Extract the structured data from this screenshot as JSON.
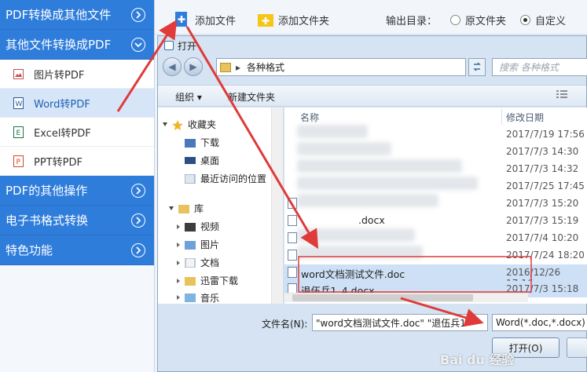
{
  "sidebar": {
    "sections": [
      {
        "label": "PDF转换成其他文件",
        "state": "collapsed"
      },
      {
        "label": "其他文件转换成PDF",
        "state": "expanded"
      }
    ],
    "items": [
      {
        "label": "图片转PDF",
        "icon": "image-icon"
      },
      {
        "label": "Word转PDF",
        "icon": "word-icon",
        "selected": true
      },
      {
        "label": "Excel转PDF",
        "icon": "excel-icon"
      },
      {
        "label": "PPT转PDF",
        "icon": "ppt-icon"
      }
    ],
    "lower_sections": [
      {
        "label": "PDF的其他操作"
      },
      {
        "label": "电子书格式转换"
      },
      {
        "label": "特色功能"
      }
    ]
  },
  "toolbar": {
    "add_file": "添加文件",
    "add_folder": "添加文件夹",
    "output_label": "输出目录：",
    "radio_source": "原文件夹",
    "radio_custom": "自定义",
    "selected_radio": "custom"
  },
  "dialog": {
    "title": "打开",
    "address": "各种格式",
    "search_placeholder": "搜索 各种格式",
    "organize": "组织",
    "new_folder": "新建文件夹",
    "tree": {
      "favorites": "收藏夹",
      "favorites_items": [
        "下载",
        "桌面",
        "最近访问的位置"
      ],
      "library": "库",
      "library_items": [
        "视频",
        "图片",
        "文档",
        "迅雷下载",
        "音乐"
      ]
    },
    "columns": {
      "name": "名称",
      "date": "修改日期"
    },
    "files": [
      {
        "name": "",
        "date": "2017/7/19 17:56"
      },
      {
        "name": "",
        "date": "2017/7/3 14:30"
      },
      {
        "name": "",
        "date": "2017/7/3 14:32"
      },
      {
        "name": "",
        "date": "2017/7/25 17:45"
      },
      {
        "name": "",
        "date": "2017/7/3 15:20"
      },
      {
        "name": ".docx",
        "date": "2017/7/3 15:19"
      },
      {
        "name": "",
        "date": "2017/7/4 10:20"
      },
      {
        "name": "",
        "date": "2017/7/24 18:20"
      },
      {
        "name": "word文档测试文件.doc",
        "date": "2016/12/26 17:16",
        "highlighted": true
      },
      {
        "name": "退伍兵1_4.docx",
        "date": "2017/7/3 15:18",
        "highlighted": true
      }
    ],
    "filename_label": "文件名(N):",
    "filename_value": "\"word文档测试文件.doc\" \"退伍兵1",
    "filetype": "Word(*.doc,*.docx)",
    "open_button": "打开(O)"
  },
  "colors": {
    "sidebar_blue": "#2f7ddb",
    "arrow_red": "#e03a3a",
    "highlight_row": "#cde0f6"
  },
  "watermark": "Bai du 经验"
}
